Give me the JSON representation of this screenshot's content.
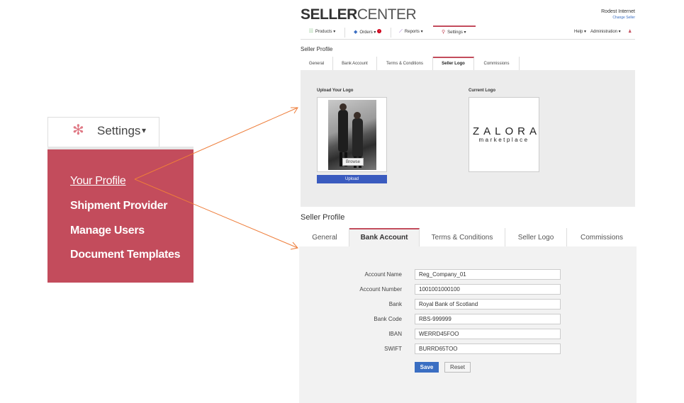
{
  "menu": {
    "tab_label": "Settings",
    "caret": "▾",
    "items": [
      {
        "label": "Your Profile"
      },
      {
        "label": "Shipment Provider"
      },
      {
        "label": "Manage Users"
      },
      {
        "label": "Document Templates"
      }
    ]
  },
  "header": {
    "brand_bold": "SELLER",
    "brand_light": "CENTER",
    "user_name": "Rodest Internet",
    "change_seller": "Change Seller"
  },
  "topnav": {
    "items": [
      {
        "label": "Products",
        "icon": "grid-icon"
      },
      {
        "label": "Orders",
        "icon": "tag-icon",
        "badge": "!"
      },
      {
        "label": "Reports",
        "icon": "chart-icon"
      },
      {
        "label": "Settings",
        "icon": "search-icon"
      }
    ],
    "help": "Help",
    "administration": "Administration"
  },
  "logo_page": {
    "title": "Seller Profile",
    "tabs": [
      "General",
      "Bank Account",
      "Terms & Conditions",
      "Seller Logo",
      "Commissions"
    ],
    "active_tab": "Seller Logo",
    "upload_label": "Upload Your Logo",
    "current_label": "Current Logo",
    "browse": "Browse",
    "upload": "Upload",
    "logo_line1": "ZALORA",
    "logo_line2": "marketplace"
  },
  "bank_page": {
    "title": "Seller Profile",
    "tabs": [
      "General",
      "Bank Account",
      "Terms & Conditions",
      "Seller Logo",
      "Commissions"
    ],
    "active_tab": "Bank Account",
    "fields": [
      {
        "label": "Account Name",
        "value": "Reg_Company_01"
      },
      {
        "label": "Account Number",
        "value": "1001001000100"
      },
      {
        "label": "Bank",
        "value": "Royal Bank of Scotland"
      },
      {
        "label": "Bank Code",
        "value": "RBS-999999"
      },
      {
        "label": "IBAN",
        "value": "WERRD45FOO"
      },
      {
        "label": "SWIFT",
        "value": "BURRD65TOO"
      }
    ],
    "save": "Save",
    "reset": "Reset"
  },
  "colors": {
    "menu_bg": "#c34c5c",
    "accent_blue": "#3a6ec2",
    "arrow": "#ee7d3a"
  }
}
